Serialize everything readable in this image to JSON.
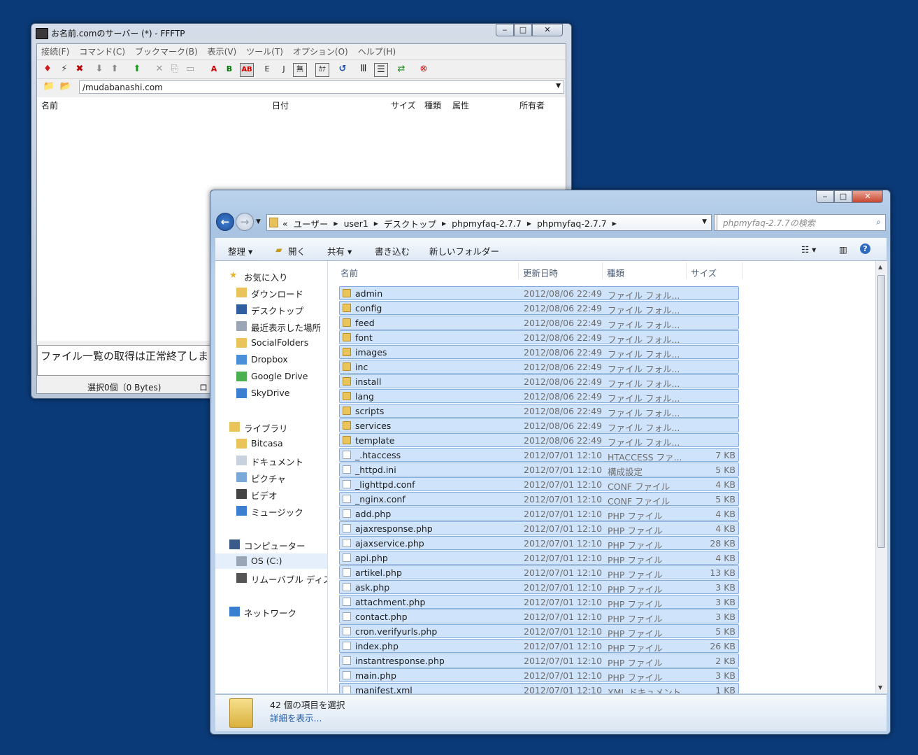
{
  "ftp": {
    "title": "お名前.comのサーバー (*) - FFFTP",
    "menu": [
      "接続(F)",
      "コマンド(C)",
      "ブックマーク(B)",
      "表示(V)",
      "ツール(T)",
      "オプション(O)",
      "ヘルプ(H)"
    ],
    "path": "/mudabanashi.com",
    "columns": [
      "名前",
      "日付",
      "サイズ",
      "種類",
      "属性",
      "所有者"
    ],
    "log": "ファイル一覧の取得は正常終了しま",
    "status": "選択0個（0 Bytes)",
    "status_trunc": "ロ"
  },
  "explorer": {
    "breadcrumbs": [
      "ユーザー",
      "user1",
      "デスクトップ",
      "phpmyfaq-2.7.7",
      "phpmyfaq-2.7.7"
    ],
    "breadcrumb_prefix": "«",
    "search_placeholder": "phpmyfaq-2.7.7の検索",
    "commands": [
      "整理 ▾",
      "開く",
      "共有 ▾",
      "書き込む",
      "新しいフォルダー"
    ],
    "nav": [
      {
        "label": "お気に入り",
        "icon": "star-icon",
        "indent": 0,
        "group": true
      },
      {
        "label": "ダウンロード",
        "icon": "download-folder-icon",
        "indent": 1
      },
      {
        "label": "デスクトップ",
        "icon": "desktop-icon",
        "indent": 1
      },
      {
        "label": "最近表示した場所",
        "icon": "recent-places-icon",
        "indent": 1
      },
      {
        "label": "SocialFolders",
        "icon": "folder-icon",
        "indent": 1
      },
      {
        "label": "Dropbox",
        "icon": "dropbox-icon",
        "indent": 1
      },
      {
        "label": "Google Drive",
        "icon": "google-drive-icon",
        "indent": 1
      },
      {
        "label": "SkyDrive",
        "icon": "skydrive-icon",
        "indent": 1
      },
      {
        "label": "ライブラリ",
        "icon": "library-icon",
        "indent": 0,
        "group": true
      },
      {
        "label": "Bitcasa",
        "icon": "folder-icon",
        "indent": 1
      },
      {
        "label": "ドキュメント",
        "icon": "documents-icon",
        "indent": 1
      },
      {
        "label": "ピクチャ",
        "icon": "pictures-icon",
        "indent": 1
      },
      {
        "label": "ビデオ",
        "icon": "videos-icon",
        "indent": 1
      },
      {
        "label": "ミュージック",
        "icon": "music-icon",
        "indent": 1
      },
      {
        "label": "コンピューター",
        "icon": "computer-icon",
        "indent": 0,
        "group": true
      },
      {
        "label": "OS (C:)",
        "icon": "drive-icon",
        "indent": 1,
        "selected": true
      },
      {
        "label": "リムーバブル ディスク",
        "icon": "removable-disk-icon",
        "indent": 1
      },
      {
        "label": "ネットワーク",
        "icon": "network-icon",
        "indent": 0,
        "group": true
      }
    ],
    "columns": [
      "名前",
      "更新日時",
      "種類",
      "サイズ"
    ],
    "files": [
      {
        "name": "admin",
        "date": "2012/08/06 22:49",
        "type": "ファイル フォル...",
        "size": "",
        "kind": "folder"
      },
      {
        "name": "config",
        "date": "2012/08/06 22:49",
        "type": "ファイル フォル...",
        "size": "",
        "kind": "folder"
      },
      {
        "name": "feed",
        "date": "2012/08/06 22:49",
        "type": "ファイル フォル...",
        "size": "",
        "kind": "folder"
      },
      {
        "name": "font",
        "date": "2012/08/06 22:49",
        "type": "ファイル フォル...",
        "size": "",
        "kind": "folder"
      },
      {
        "name": "images",
        "date": "2012/08/06 22:49",
        "type": "ファイル フォル...",
        "size": "",
        "kind": "folder"
      },
      {
        "name": "inc",
        "date": "2012/08/06 22:49",
        "type": "ファイル フォル...",
        "size": "",
        "kind": "folder"
      },
      {
        "name": "install",
        "date": "2012/08/06 22:49",
        "type": "ファイル フォル...",
        "size": "",
        "kind": "folder"
      },
      {
        "name": "lang",
        "date": "2012/08/06 22:49",
        "type": "ファイル フォル...",
        "size": "",
        "kind": "folder"
      },
      {
        "name": "scripts",
        "date": "2012/08/06 22:49",
        "type": "ファイル フォル...",
        "size": "",
        "kind": "folder"
      },
      {
        "name": "services",
        "date": "2012/08/06 22:49",
        "type": "ファイル フォル...",
        "size": "",
        "kind": "folder"
      },
      {
        "name": "template",
        "date": "2012/08/06 22:49",
        "type": "ファイル フォル...",
        "size": "",
        "kind": "folder"
      },
      {
        "name": "_.htaccess",
        "date": "2012/07/01 12:10",
        "type": "HTACCESS ファ...",
        "size": "7 KB",
        "kind": "file"
      },
      {
        "name": "_httpd.ini",
        "date": "2012/07/01 12:10",
        "type": "構成設定",
        "size": "5 KB",
        "kind": "file"
      },
      {
        "name": "_lighttpd.conf",
        "date": "2012/07/01 12:10",
        "type": "CONF ファイル",
        "size": "4 KB",
        "kind": "file"
      },
      {
        "name": "_nginx.conf",
        "date": "2012/07/01 12:10",
        "type": "CONF ファイル",
        "size": "5 KB",
        "kind": "file"
      },
      {
        "name": "add.php",
        "date": "2012/07/01 12:10",
        "type": "PHP ファイル",
        "size": "4 KB",
        "kind": "file"
      },
      {
        "name": "ajaxresponse.php",
        "date": "2012/07/01 12:10",
        "type": "PHP ファイル",
        "size": "4 KB",
        "kind": "file"
      },
      {
        "name": "ajaxservice.php",
        "date": "2012/07/01 12:10",
        "type": "PHP ファイル",
        "size": "28 KB",
        "kind": "file"
      },
      {
        "name": "api.php",
        "date": "2012/07/01 12:10",
        "type": "PHP ファイル",
        "size": "4 KB",
        "kind": "file"
      },
      {
        "name": "artikel.php",
        "date": "2012/07/01 12:10",
        "type": "PHP ファイル",
        "size": "13 KB",
        "kind": "file"
      },
      {
        "name": "ask.php",
        "date": "2012/07/01 12:10",
        "type": "PHP ファイル",
        "size": "3 KB",
        "kind": "file"
      },
      {
        "name": "attachment.php",
        "date": "2012/07/01 12:10",
        "type": "PHP ファイル",
        "size": "3 KB",
        "kind": "file"
      },
      {
        "name": "contact.php",
        "date": "2012/07/01 12:10",
        "type": "PHP ファイル",
        "size": "3 KB",
        "kind": "file"
      },
      {
        "name": "cron.verifyurls.php",
        "date": "2012/07/01 12:10",
        "type": "PHP ファイル",
        "size": "5 KB",
        "kind": "file"
      },
      {
        "name": "index.php",
        "date": "2012/07/01 12:10",
        "type": "PHP ファイル",
        "size": "26 KB",
        "kind": "file"
      },
      {
        "name": "instantresponse.php",
        "date": "2012/07/01 12:10",
        "type": "PHP ファイル",
        "size": "2 KB",
        "kind": "file"
      },
      {
        "name": "main.php",
        "date": "2012/07/01 12:10",
        "type": "PHP ファイル",
        "size": "3 KB",
        "kind": "file"
      },
      {
        "name": "manifest.xml",
        "date": "2012/07/01 12:10",
        "type": "XML ドキュメント",
        "size": "1 KB",
        "kind": "file"
      }
    ],
    "details": {
      "count": "42 個の項目を選択",
      "link": "詳細を表示..."
    }
  },
  "colors": {
    "desktop": "#0b3a78",
    "selection": "#cfe3fa",
    "selection_border": "#84acdd",
    "close": "#c8462f"
  }
}
